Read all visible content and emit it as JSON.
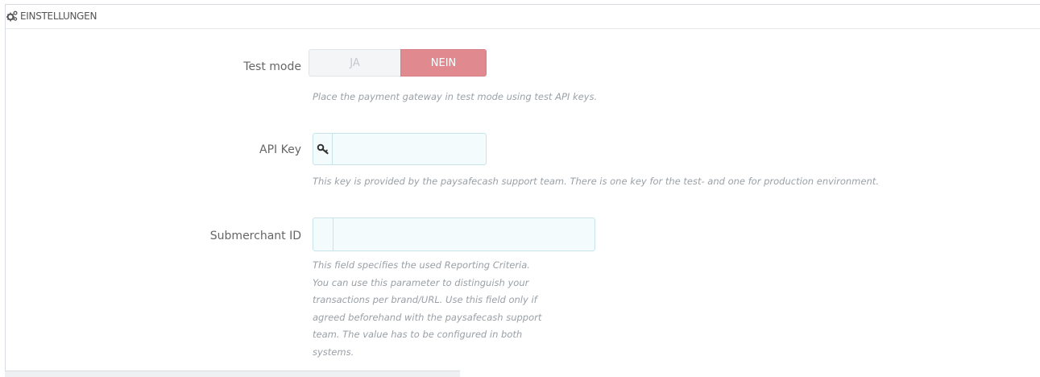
{
  "header": {
    "title": "EINSTELLUNGEN",
    "icon": "cogs-icon"
  },
  "test_mode": {
    "label": "Test mode",
    "options": [
      "JA",
      "NEIN"
    ],
    "selected": "NEIN",
    "help": "Place the payment gateway in test mode using test API keys."
  },
  "api_key": {
    "label": "API Key",
    "icon": "key-icon",
    "value": "",
    "help": "This key is provided by the paysafecash support team. There is one key for the test- and one for production environment."
  },
  "submerchant": {
    "label": "Submerchant ID",
    "value": "",
    "help_lines": [
      "This field specifies the used Reporting Criteria.",
      "You can use this parameter to distinguish your",
      "transactions per brand/URL. Use this field only if",
      "agreed beforehand with the paysafecash support",
      "team. The value has to be configured in both",
      "systems."
    ]
  },
  "colors": {
    "switch_active": "#e08a8f",
    "input_border": "#c9e3ea",
    "input_background": "#f3fbfd"
  }
}
